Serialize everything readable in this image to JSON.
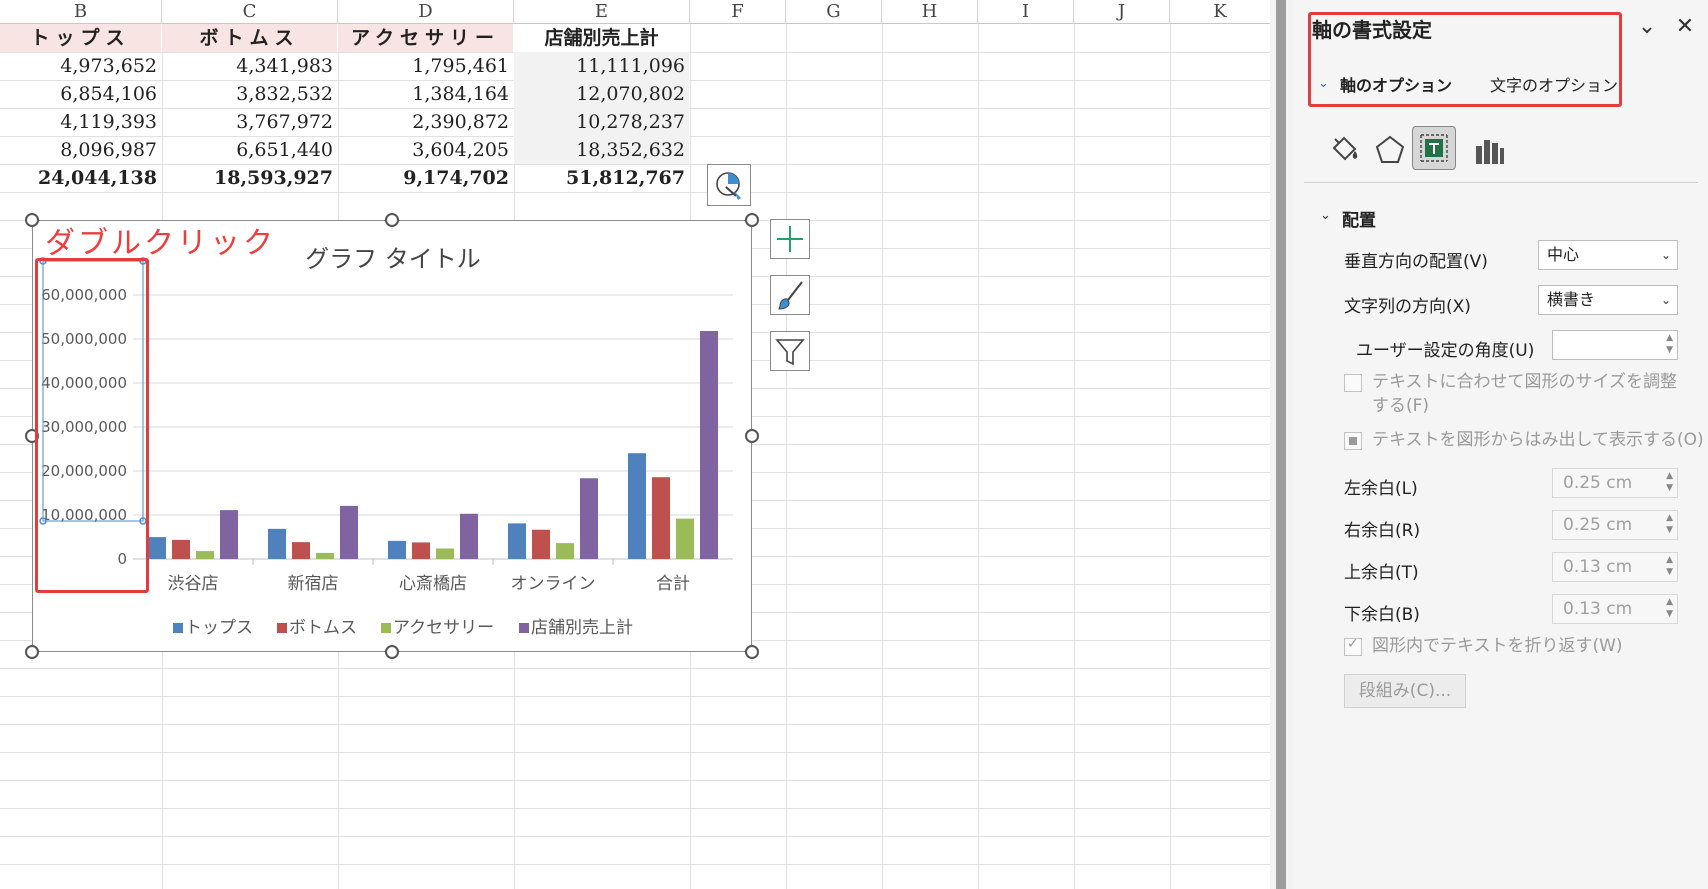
{
  "sheet": {
    "columns": [
      "B",
      "C",
      "D",
      "E",
      "F",
      "G",
      "H",
      "I",
      "J",
      "K"
    ],
    "headers": [
      "トップス",
      "ボトムス",
      "アクセサリー",
      "店舗別売上計"
    ],
    "rows": [
      [
        "4,973,652",
        "4,341,983",
        "1,795,461",
        "11,111,096"
      ],
      [
        "6,854,106",
        "3,832,532",
        "1,384,164",
        "12,070,802"
      ],
      [
        "4,119,393",
        "3,767,972",
        "2,390,872",
        "10,278,237"
      ],
      [
        "8,096,987",
        "6,651,440",
        "3,604,205",
        "18,352,632"
      ]
    ],
    "totals": [
      "24,044,138",
      "18,593,927",
      "9,174,702",
      "51,812,767"
    ]
  },
  "annotation": "ダブルクリック",
  "chart_data": {
    "type": "bar",
    "title": "グラフ タイトル",
    "categories": [
      "渋谷店",
      "新宿店",
      "心斎橋店",
      "オンライン",
      "合計"
    ],
    "series": [
      {
        "name": "トップス",
        "color": "#4f81bd",
        "values": [
          4973652,
          6854106,
          4119393,
          8096987,
          24044138
        ]
      },
      {
        "name": "ボトムス",
        "color": "#c0504d",
        "values": [
          4341983,
          3832532,
          3767972,
          6651440,
          18593927
        ]
      },
      {
        "name": "アクセサリー",
        "color": "#9bbb59",
        "values": [
          1795461,
          1384164,
          2390872,
          3604205,
          9174702
        ]
      },
      {
        "name": "店舗別売上計",
        "color": "#8064a2",
        "values": [
          11111096,
          12070802,
          10278237,
          18352632,
          51812767
        ]
      }
    ],
    "ylim": [
      0,
      60000000
    ],
    "yticks": [
      "0",
      "10,000,000",
      "20,000,000",
      "30,000,000",
      "40,000,000",
      "50,000,000",
      "60,000,000"
    ],
    "grid": true,
    "legend": "bottom"
  },
  "pane": {
    "title": "軸の書式設定",
    "tab_axis": "軸のオプション",
    "tab_text": "文字のオプション",
    "section": "配置",
    "vertical_align_label": "垂直方向の配置(V)",
    "vertical_align_value": "中心",
    "text_direction_label": "文字列の方向(X)",
    "text_direction_value": "横書き",
    "custom_angle_label": "ユーザー設定の角度(U)",
    "autofit_label": "テキストに合わせて図形のサイズを調整する(F)",
    "overflow_label": "テキストを図形からはみ出して表示する(O)",
    "left_margin_label": "左余白(L)",
    "left_margin_value": "0.25 cm",
    "right_margin_label": "右余白(R)",
    "right_margin_value": "0.25 cm",
    "top_margin_label": "上余白(T)",
    "top_margin_value": "0.13 cm",
    "bottom_margin_label": "下余白(B)",
    "bottom_margin_value": "0.13 cm",
    "wrap_label": "図形内でテキストを折り返す(W)",
    "columns_button": "段組み(C)..."
  }
}
